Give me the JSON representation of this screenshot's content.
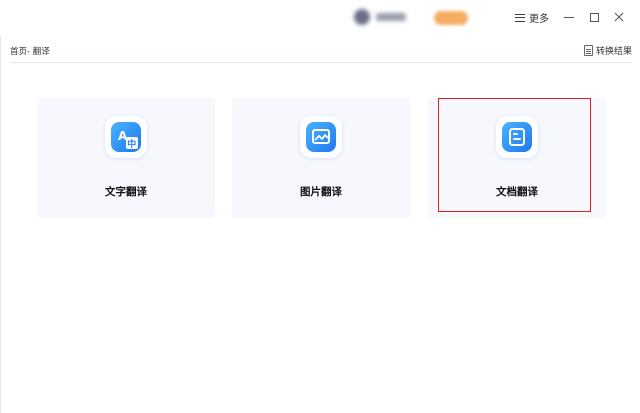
{
  "titlebar": {
    "more_label": "更多"
  },
  "breadcrumb": {
    "text": "首页- 翻译"
  },
  "toolbar": {
    "convert_result_label": "转换结果"
  },
  "cards": [
    {
      "label": "文字翻译",
      "icon": "text-translate-icon"
    },
    {
      "label": "图片翻译",
      "icon": "image-translate-icon"
    },
    {
      "label": "文档翻译",
      "icon": "document-translate-icon"
    }
  ],
  "colors": {
    "accent": "#1f78f0",
    "highlight": "#e02020",
    "card_bg": "#f6f8fd"
  }
}
